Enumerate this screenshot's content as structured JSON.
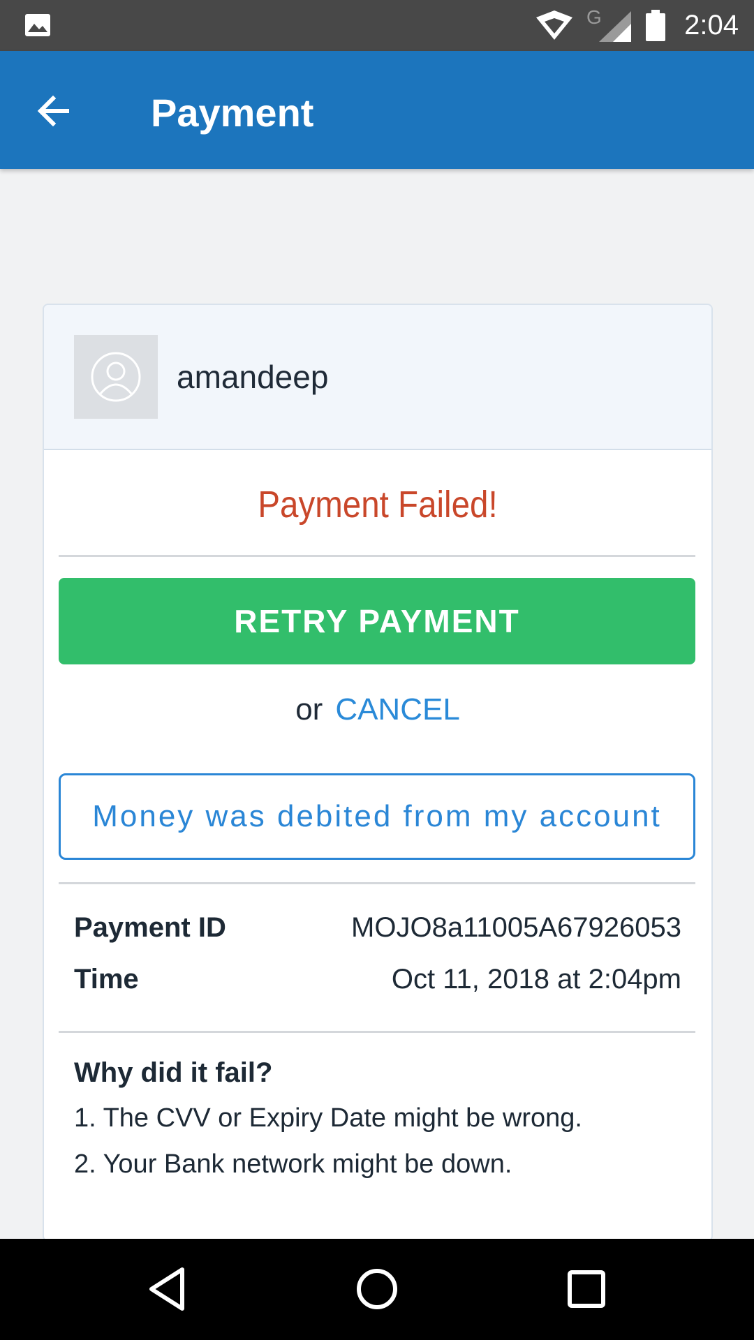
{
  "status_bar": {
    "time": "2:04",
    "network_type": "G",
    "icons": [
      "gallery-icon",
      "wifi-icon",
      "signal-icon",
      "battery-icon"
    ]
  },
  "app_bar": {
    "title": "Payment",
    "back_icon": "arrow-left-icon",
    "color": "#1c75bd"
  },
  "merchant": {
    "name": "amandeep",
    "avatar_icon": "user-avatar-icon"
  },
  "payment": {
    "status_title": "Payment Failed!",
    "status_color": "#c9472a",
    "retry_label": "RETRY PAYMENT",
    "retry_color": "#32be6b",
    "or_text": "or",
    "cancel_label": "CANCEL",
    "debited_label": "Money was debited from my account",
    "accent_color": "#2a86d6"
  },
  "details": {
    "payment_id_label": "Payment ID",
    "payment_id_value": "MOJO8a11005A67926053",
    "time_label": "Time",
    "time_value": "Oct 11, 2018 at 2:04pm"
  },
  "failure": {
    "title": "Why did it fail?",
    "reasons": [
      "1.  The CVV or Expiry Date might be wrong.",
      "2.  Your Bank network might be down."
    ]
  },
  "nav_bar": {
    "icons": [
      "back-triangle-icon",
      "home-circle-icon",
      "recents-square-icon"
    ]
  }
}
